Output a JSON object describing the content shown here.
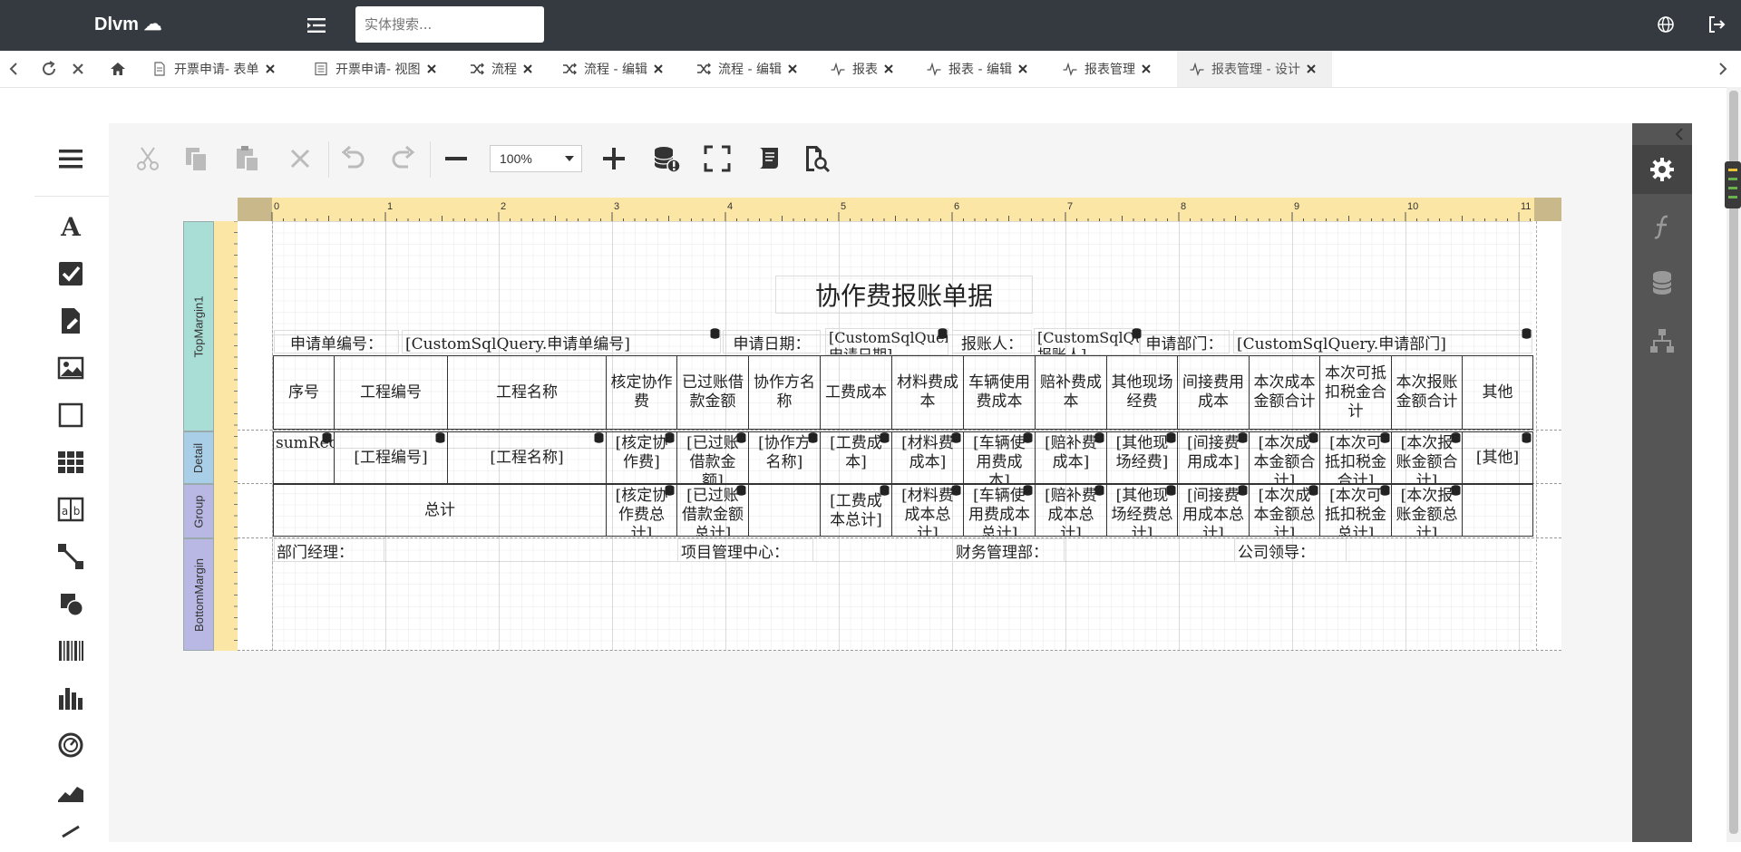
{
  "header": {
    "logo": "Dlvm ☁",
    "search_placeholder": "实体搜索..."
  },
  "tabs": [
    {
      "label": "开票申请- 表单"
    },
    {
      "label": "开票申请- 视图"
    },
    {
      "label": "流程"
    },
    {
      "label": "流程 - 编辑"
    },
    {
      "label": "流程 - 编辑"
    },
    {
      "label": "报表"
    },
    {
      "label": "报表 - 编辑"
    },
    {
      "label": "报表管理"
    },
    {
      "label": "报表管理 - 设计"
    }
  ],
  "toolbar": {
    "zoom": "100%"
  },
  "ruler": {
    "top_ticks": [
      "0",
      "1",
      "2",
      "3",
      "4",
      "5",
      "6",
      "7",
      "8",
      "9",
      "10",
      "11"
    ]
  },
  "bands": {
    "top_margin": "TopMargin1",
    "detail": "Detail",
    "group": "Group",
    "bottom_margin": "BottomMargin"
  },
  "report": {
    "title": "协作费报账单据",
    "fields": {
      "req_no_label": "申请单编号：",
      "req_no_value": "[CustomSqlQuery.申请单编号]",
      "req_date_label": "申请日期：",
      "req_date_value": "[CustomSqlQuery.申请日期]",
      "reporter_label": "报账人：",
      "reporter_value": "[CustomSqlQuery.报账人]",
      "dept_label": "申请部门：",
      "dept_value": "[CustomSqlQuery.申请部门]"
    },
    "columns": [
      "序号",
      "工程编号",
      "工程名称",
      "核定协作费",
      "已过账借款金额",
      "协作方名称",
      "工费成本",
      "材料费成本",
      "车辆使用费成本",
      "赔补费成本",
      "其他现场经费",
      "间接费用成本",
      "本次成本金额合计",
      "本次可抵扣税金合计",
      "本次报账金额合计",
      "其他"
    ],
    "detail_cells": [
      "sumRecordNumber()",
      "[工程编号]",
      "[工程名称]",
      "[核定协作费]",
      "[已过账借款金额]",
      "[协作方名称]",
      "[工费成本]",
      "[材料费成本]",
      "[车辆使用费成本]",
      "[赔补费成本]",
      "[其他现场经费]",
      "[间接费用成本]",
      "[本次成本金额合计]",
      "[本次可抵扣税金合计]",
      "[本次报账金额合计]",
      "[其他]"
    ],
    "group_total_label": "总计",
    "group_cells": [
      "[核定协作费总计]",
      "[已过账借款金额总计]",
      "",
      "[工费成本总计]",
      "[材料费成本总计]",
      "[车辆使用费成本总计]",
      "[赔补费成本总计]",
      "[其他现场经费总计]",
      "[间接费用成本总计]",
      "[本次成本金额总计]",
      "[本次可抵扣税金总计]",
      "[本次报账金额总计]",
      ""
    ],
    "signatures": [
      "部门经理：",
      "项目管理中心：",
      "财务管理部：",
      "公司领导："
    ]
  }
}
